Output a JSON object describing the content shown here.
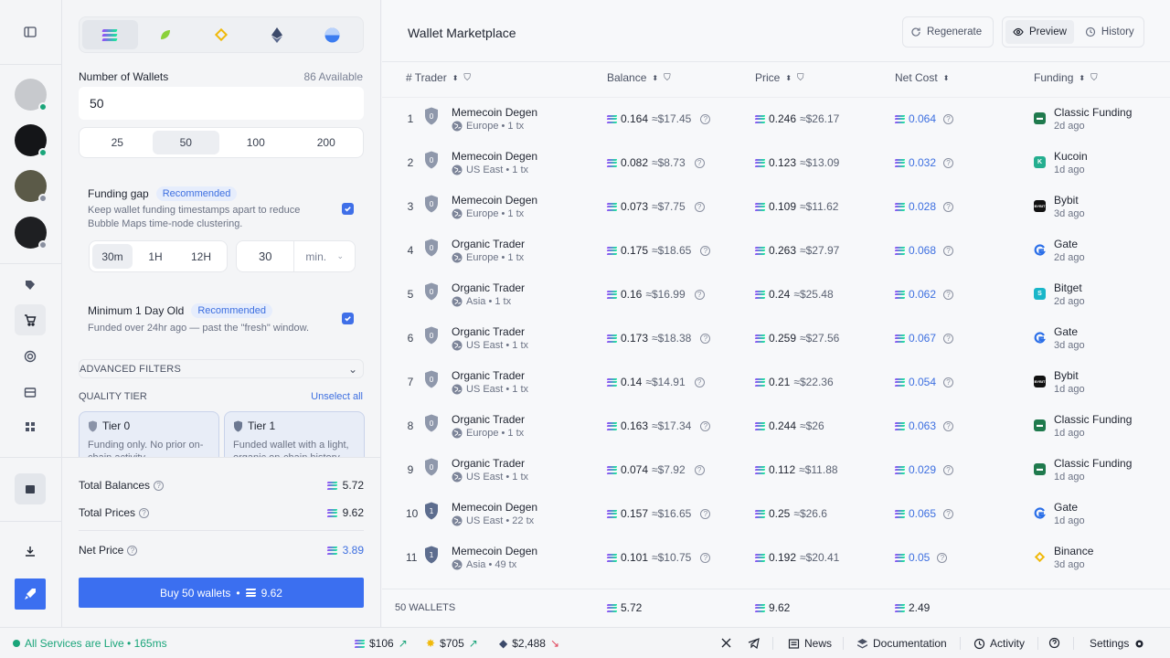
{
  "panel": {
    "wallets_label": "Number of Wallets",
    "available": "86 Available",
    "wallet_count": "50",
    "count_options": [
      "25",
      "50",
      "100",
      "200"
    ],
    "funding_gap": {
      "title": "Funding gap",
      "badge": "Recommended",
      "desc": "Keep wallet funding timestamps apart to reduce Bubble Maps time-node clustering.",
      "units": [
        "30m",
        "1H",
        "12H"
      ],
      "value": "30",
      "unit_select": "min."
    },
    "min_age": {
      "title": "Minimum 1 Day Old",
      "badge": "Recommended",
      "desc": "Funded over 24hr ago — past the \"fresh\" window."
    },
    "advanced": "ADVANCED FILTERS",
    "quality_tier": "QUALITY TIER",
    "unselect": "Unselect all",
    "tiers": [
      {
        "title": "Tier 0",
        "desc": "Funding only. No prior on-chain activity."
      },
      {
        "title": "Tier 1",
        "desc": "Funded wallet with a light, organic on-chain history."
      }
    ],
    "total_balances_label": "Total Balances",
    "total_balances": "5.72",
    "total_prices_label": "Total Prices",
    "total_prices": "9.62",
    "net_price_label": "Net Price",
    "net_price": "3.89",
    "buy_label": "Buy 50 wallets",
    "buy_bullet": "•",
    "buy_amount": "9.62"
  },
  "main": {
    "title": "Wallet Marketplace",
    "regenerate": "Regenerate",
    "preview": "Preview",
    "history": "History",
    "headers": [
      "# Trader",
      "Balance",
      "Price",
      "Net Cost",
      "Funding"
    ],
    "rows": [
      {
        "n": "1",
        "tier": "0",
        "trader": "Memecoin Degen",
        "loc": "Europe • 1 tx",
        "bal": "0.164",
        "bal_usd": "≈$17.45",
        "price": "0.246",
        "price_usd": "≈$26.17",
        "net": "0.064",
        "fund": "Classic Funding",
        "ago": "2d ago",
        "ex": "classic"
      },
      {
        "n": "2",
        "tier": "0",
        "trader": "Memecoin Degen",
        "loc": "US East • 1 tx",
        "bal": "0.082",
        "bal_usd": "≈$8.73",
        "price": "0.123",
        "price_usd": "≈$13.09",
        "net": "0.032",
        "fund": "Kucoin",
        "ago": "1d ago",
        "ex": "kucoin"
      },
      {
        "n": "3",
        "tier": "0",
        "trader": "Memecoin Degen",
        "loc": "Europe • 1 tx",
        "bal": "0.073",
        "bal_usd": "≈$7.75",
        "price": "0.109",
        "price_usd": "≈$11.62",
        "net": "0.028",
        "fund": "Bybit",
        "ago": "3d ago",
        "ex": "bybit"
      },
      {
        "n": "4",
        "tier": "0",
        "trader": "Organic Trader",
        "loc": "Europe • 1 tx",
        "bal": "0.175",
        "bal_usd": "≈$18.65",
        "price": "0.263",
        "price_usd": "≈$27.97",
        "net": "0.068",
        "fund": "Gate",
        "ago": "2d ago",
        "ex": "gate"
      },
      {
        "n": "5",
        "tier": "0",
        "trader": "Organic Trader",
        "loc": "Asia • 1 tx",
        "bal": "0.16",
        "bal_usd": "≈$16.99",
        "price": "0.24",
        "price_usd": "≈$25.48",
        "net": "0.062",
        "fund": "Bitget",
        "ago": "2d ago",
        "ex": "bitget"
      },
      {
        "n": "6",
        "tier": "0",
        "trader": "Organic Trader",
        "loc": "US East • 1 tx",
        "bal": "0.173",
        "bal_usd": "≈$18.38",
        "price": "0.259",
        "price_usd": "≈$27.56",
        "net": "0.067",
        "fund": "Gate",
        "ago": "3d ago",
        "ex": "gate"
      },
      {
        "n": "7",
        "tier": "0",
        "trader": "Organic Trader",
        "loc": "US East • 1 tx",
        "bal": "0.14",
        "bal_usd": "≈$14.91",
        "price": "0.21",
        "price_usd": "≈$22.36",
        "net": "0.054",
        "fund": "Bybit",
        "ago": "1d ago",
        "ex": "bybit"
      },
      {
        "n": "8",
        "tier": "0",
        "trader": "Organic Trader",
        "loc": "Europe • 1 tx",
        "bal": "0.163",
        "bal_usd": "≈$17.34",
        "price": "0.244",
        "price_usd": "≈$26",
        "net": "0.063",
        "fund": "Classic Funding",
        "ago": "1d ago",
        "ex": "classic"
      },
      {
        "n": "9",
        "tier": "0",
        "trader": "Organic Trader",
        "loc": "US East • 1 tx",
        "bal": "0.074",
        "bal_usd": "≈$7.92",
        "price": "0.112",
        "price_usd": "≈$11.88",
        "net": "0.029",
        "fund": "Classic Funding",
        "ago": "1d ago",
        "ex": "classic"
      },
      {
        "n": "10",
        "tier": "1",
        "trader": "Memecoin Degen",
        "loc": "US East • 22 tx",
        "bal": "0.157",
        "bal_usd": "≈$16.65",
        "price": "0.25",
        "price_usd": "≈$26.6",
        "net": "0.065",
        "fund": "Gate",
        "ago": "1d ago",
        "ex": "gate"
      },
      {
        "n": "11",
        "tier": "1",
        "trader": "Memecoin Degen",
        "loc": "Asia • 49 tx",
        "bal": "0.101",
        "bal_usd": "≈$10.75",
        "price": "0.192",
        "price_usd": "≈$20.41",
        "net": "0.05",
        "fund": "Binance",
        "ago": "3d ago",
        "ex": "binance"
      }
    ],
    "footer": {
      "count": "50 WALLETS",
      "bal": "5.72",
      "price": "9.62",
      "net": "2.49"
    }
  },
  "status": {
    "live": "All Services are Live • 165ms",
    "sol": "$106",
    "bnb": "$705",
    "eth": "$2,488",
    "news": "News",
    "docs": "Documentation",
    "activity": "Activity",
    "settings": "Settings"
  },
  "colors": {
    "accent": "#3b6ff0",
    "live": "#1aa57a",
    "up": "#1aa57a",
    "down": "#e0445a"
  }
}
